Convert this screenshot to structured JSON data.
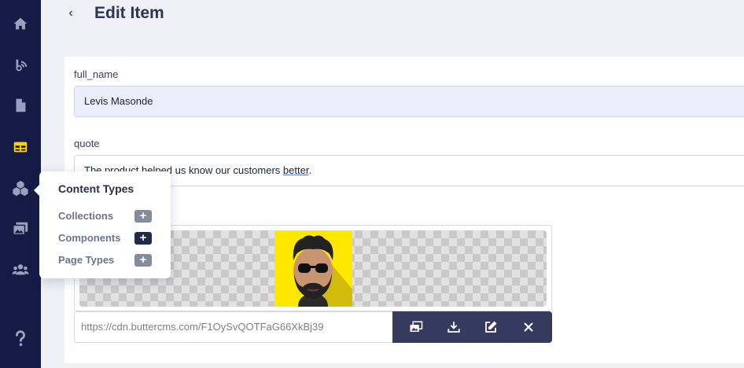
{
  "header": {
    "back_glyph": "‹",
    "title": "Edit Item"
  },
  "sidebar": {
    "items": [
      {
        "name": "home-icon",
        "active": false
      },
      {
        "name": "blog-icon",
        "active": false
      },
      {
        "name": "page-icon",
        "active": false
      },
      {
        "name": "collections-icon",
        "active": true
      },
      {
        "name": "content-types-icon",
        "active": false
      },
      {
        "name": "media-icon",
        "active": false
      },
      {
        "name": "users-icon",
        "active": false
      },
      {
        "name": "help-icon",
        "active": false
      }
    ]
  },
  "form": {
    "full_name": {
      "label": "full_name",
      "value": "Levis Masonde"
    },
    "quote": {
      "label": "quote",
      "value_before": "The product helped us know our customers ",
      "value_underlined": "better",
      "value_after": "."
    },
    "image": {
      "url": "https://cdn.buttercms.com/F1OySvQOTFaG66XkBj39"
    }
  },
  "popover": {
    "title": "Content Types",
    "items": [
      {
        "label": "Collections",
        "add": "+"
      },
      {
        "label": "Components",
        "add": "+"
      },
      {
        "label": "Page Types",
        "add": "+"
      }
    ]
  },
  "colors": {
    "sidebar_bg": "#141c46",
    "active_icon": "#ffd400",
    "toolbar_bg": "#343b5e",
    "avatar_bg": "#ffe800"
  }
}
